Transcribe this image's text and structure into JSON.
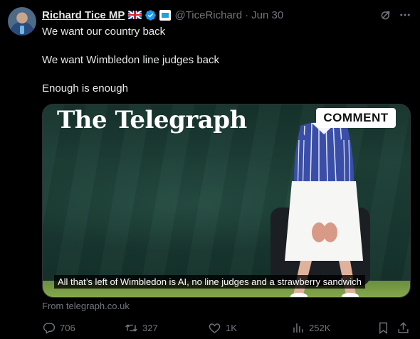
{
  "author": {
    "name": "Richard Tice MP",
    "handle": "@TiceRichard",
    "separator": "·",
    "time": "Jun 30"
  },
  "tweet": {
    "lines": [
      "We want our country back",
      "We want Wimbledon line judges back",
      "Enough is enough"
    ]
  },
  "card": {
    "masthead": "The Telegraph",
    "badge": "COMMENT",
    "caption": "All that’s left of Wimbledon is AI, no line judges and a strawberry sandwich",
    "source": "From telegraph.co.uk"
  },
  "actions": {
    "replies": "706",
    "reposts": "327",
    "likes": "1K",
    "views": "252K"
  },
  "icons": {
    "verified": "verified-badge-icon",
    "affiliate": "affiliate-badge-icon",
    "flag": "uk-flag-icon",
    "grok": "grok-icon",
    "more": "more-icon",
    "reply": "reply-icon",
    "repost": "repost-icon",
    "like": "heart-icon",
    "views": "views-icon",
    "bookmark": "bookmark-icon",
    "share": "share-icon"
  },
  "colors": {
    "background": "#000000",
    "text": "#e7e9ea",
    "muted": "#71767b",
    "verified": "#1d9bf0"
  }
}
